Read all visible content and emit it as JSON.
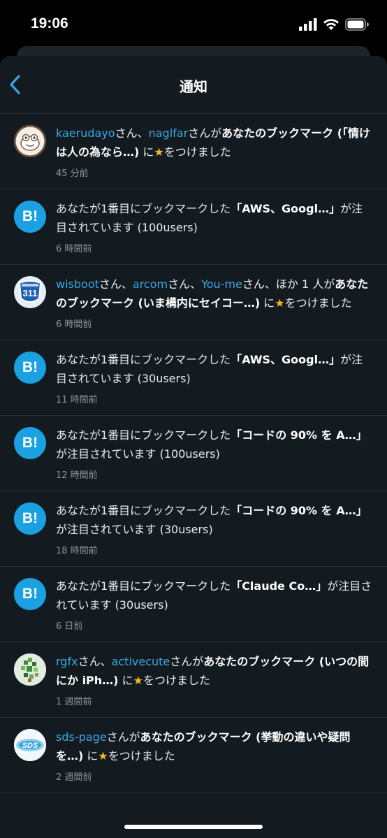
{
  "status": {
    "time": "19:06"
  },
  "nav": {
    "title": "通知"
  },
  "notifications": [
    {
      "avatar": "kaerudayo-avatar",
      "users": [
        "kaerudayo",
        "naglfar"
      ],
      "seps": [
        "さん、",
        "さんが"
      ],
      "bold": "あなたのブックマーク (「情けは人の為なら…)",
      "tail1": " に",
      "tail2": "をつけました",
      "time": "45 分前"
    },
    {
      "b": "B!",
      "prefix": "あなたが1番目にブックマークした",
      "bold": "「AWS、Googl…」",
      "suffix": "が注目されています (100users)",
      "time": "6 時間前"
    },
    {
      "avatar": "wisboot-avatar",
      "avatar_text": "311",
      "users": [
        "wisboot",
        "arcom",
        "You-me"
      ],
      "seps": [
        "さん、",
        "さん、",
        "さん、ほか 1 人が"
      ],
      "bold": "あなたのブックマーク (いま構内にセイコー…)",
      "tail1": " に",
      "tail2": "をつけました",
      "time": "6 時間前"
    },
    {
      "b": "B!",
      "prefix": "あなたが1番目にブックマークした",
      "bold": "「AWS、Googl…」",
      "suffix": "が注目されています (30users)",
      "time": "11 時間前"
    },
    {
      "b": "B!",
      "prefix": "あなたが1番目にブックマークした",
      "bold": "「コードの 90% を A…」",
      "suffix": "が注目されています (100users)",
      "time": "12 時間前"
    },
    {
      "b": "B!",
      "prefix": "あなたが1番目にブックマークした",
      "bold": "「コードの 90% を A…」",
      "suffix": "が注目されています (30users)",
      "time": "18 時間前"
    },
    {
      "b": "B!",
      "prefix": "あなたが1番目にブックマークした",
      "bold": "「Claude Co…」",
      "suffix": "が注目されています (30users)",
      "time": "6 日前"
    },
    {
      "avatar": "rgfx-avatar",
      "users": [
        "rgfx",
        "activecute"
      ],
      "seps": [
        "さん、",
        "さんが"
      ],
      "bold": "あなたのブックマーク (いつの間にか iPh…)",
      "tail1": " に",
      "tail2": "をつけました",
      "time": "1 週間前"
    },
    {
      "avatar": "sds-page-avatar",
      "avatar_text": "SDS",
      "users": [
        "sds-page"
      ],
      "seps": [
        "さんが"
      ],
      "bold": "あなたのブックマーク (挙動の違いや疑問を…)",
      "tail1": " に",
      "tail2": "をつけました",
      "time": "2 週間前"
    }
  ],
  "colors": {
    "accent": "#3aa7e6",
    "badge": "#1ba1e2",
    "star": "#f5b91e",
    "background": "#141b20"
  }
}
